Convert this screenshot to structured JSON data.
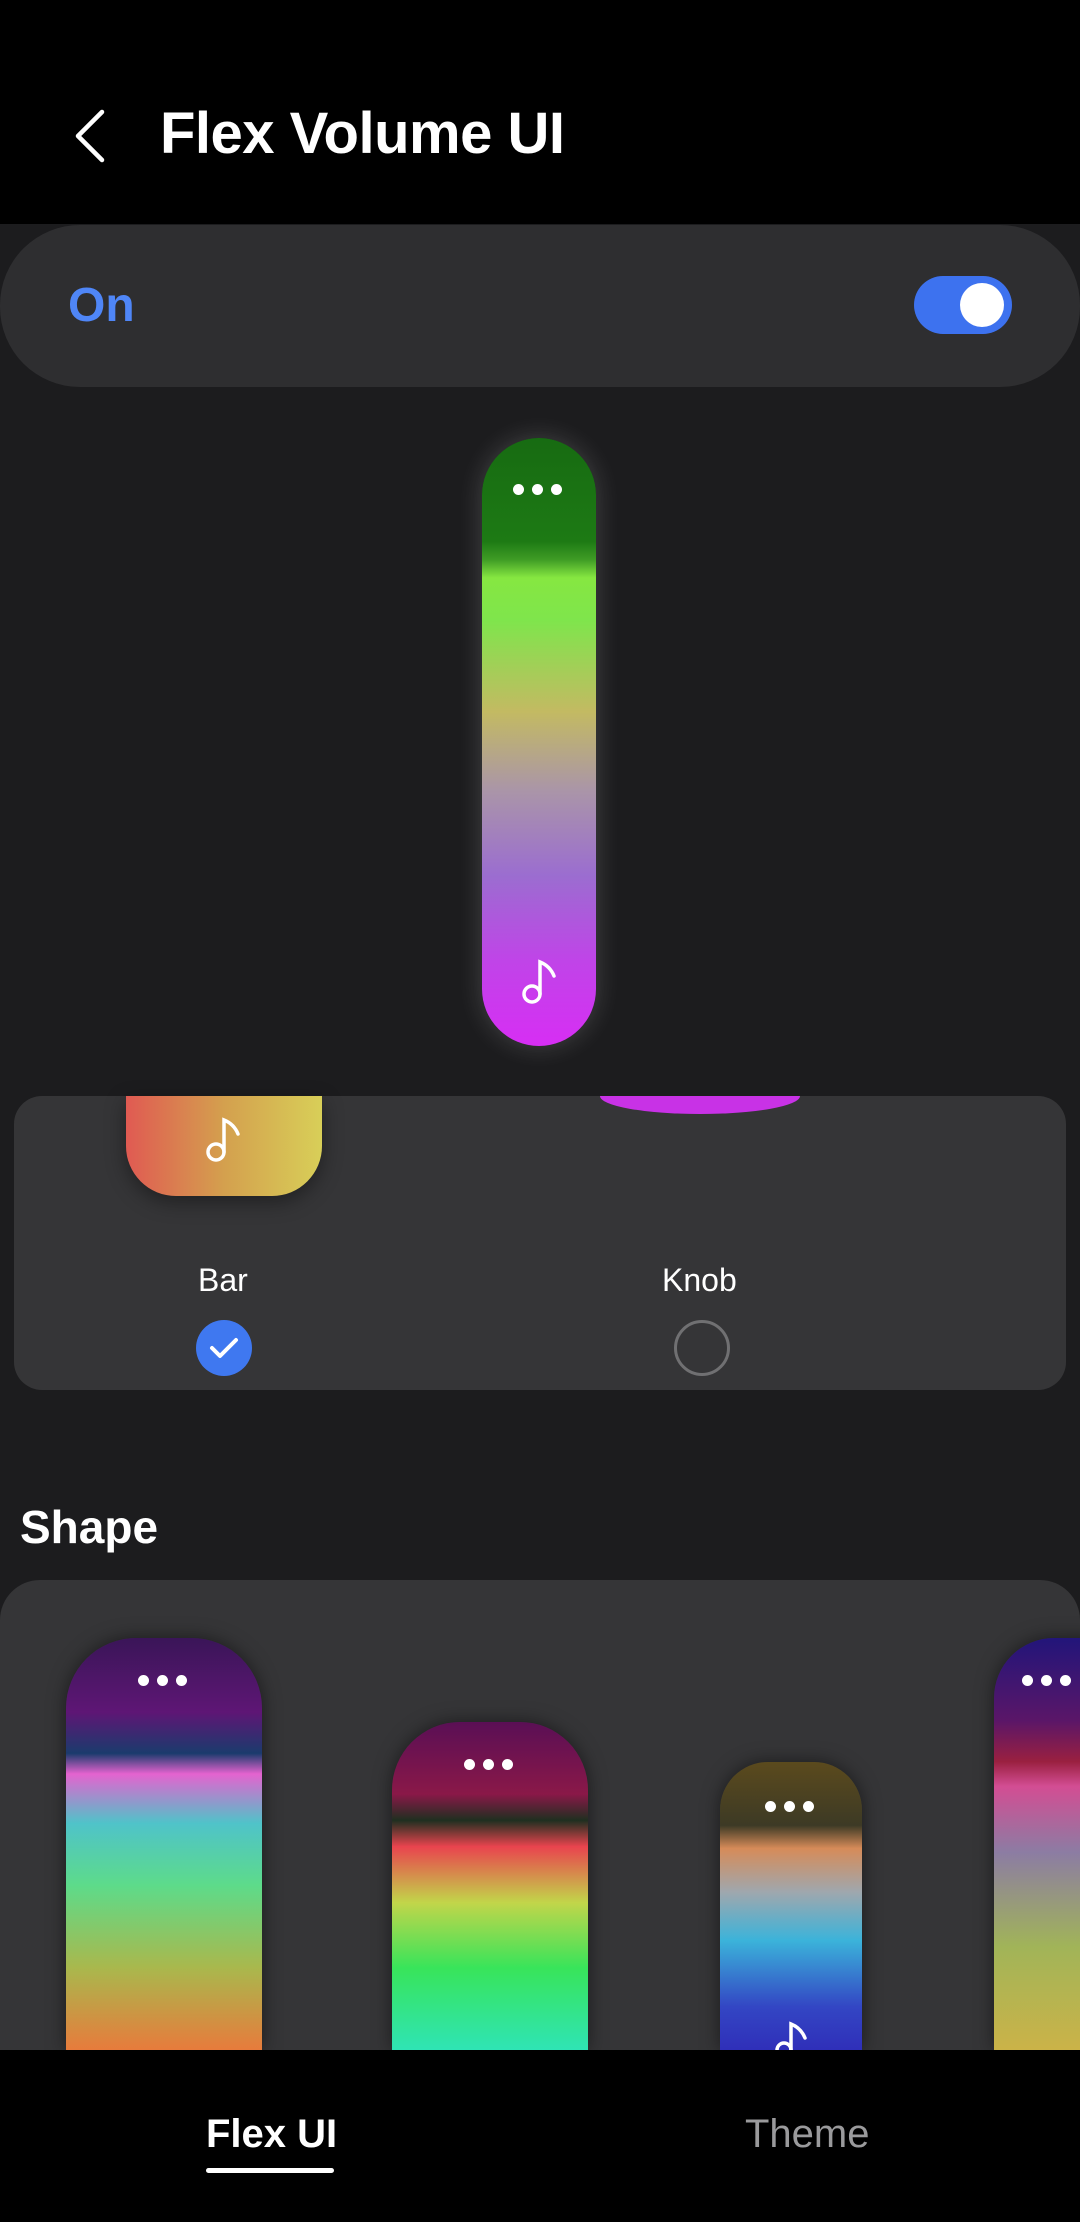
{
  "header": {
    "title": "Flex Volume UI",
    "back_icon": "chevron-left-icon"
  },
  "master_switch": {
    "label": "On",
    "enabled": true,
    "accent_color": "#3d72ef"
  },
  "preview": {
    "icons": [
      "more-dots-icon",
      "music-note-icon"
    ]
  },
  "type_selector": {
    "options": [
      {
        "label": "Bar",
        "selected": true
      },
      {
        "label": "Knob",
        "selected": false
      }
    ]
  },
  "shape_section": {
    "heading": "Shape"
  },
  "bottom_nav": {
    "tabs": [
      {
        "label": "Flex UI",
        "active": true
      },
      {
        "label": "Theme",
        "active": false
      }
    ]
  }
}
